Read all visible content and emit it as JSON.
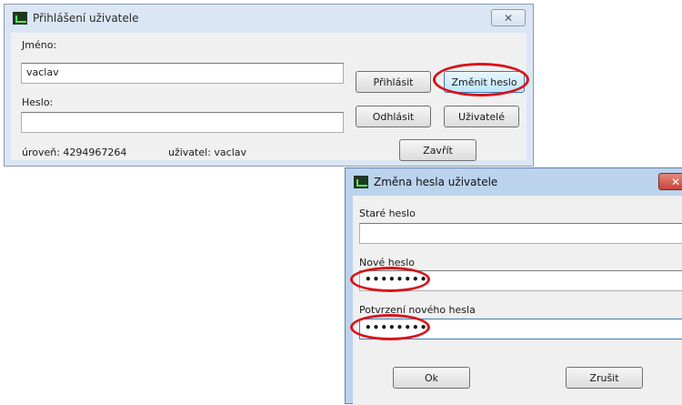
{
  "login_window": {
    "title": "Přihlášení uživatele",
    "close_glyph": "✕",
    "username_label": "Jméno:",
    "username_value": "vaclav",
    "password_label": "Heslo:",
    "password_value": "",
    "level_text": "úroveň: 4294967264",
    "user_text": "uživatel: vaclav",
    "buttons": {
      "login": "Přihlásit",
      "change_password": "Změnit heslo",
      "logout": "Odhlásit",
      "users": "Uživatelé",
      "close": "Zavřít"
    }
  },
  "change_password_window": {
    "title": "Změna hesla uživatele",
    "close_glyph": "✕",
    "old_password_label": "Staré heslo",
    "old_password_value": "",
    "new_password_label": "Nové heslo",
    "new_password_value": "••••••••",
    "confirm_password_label": "Potvrzení nového hesla",
    "confirm_password_value": "••••••••",
    "buttons": {
      "ok": "Ok",
      "cancel": "Zrušit"
    }
  },
  "colors": {
    "highlight_oval": "#d8141a",
    "inactive_titlebar": "#dbe6f4",
    "active_titlebar": "#bcd3ee",
    "close_button_red": "#c9443a"
  }
}
